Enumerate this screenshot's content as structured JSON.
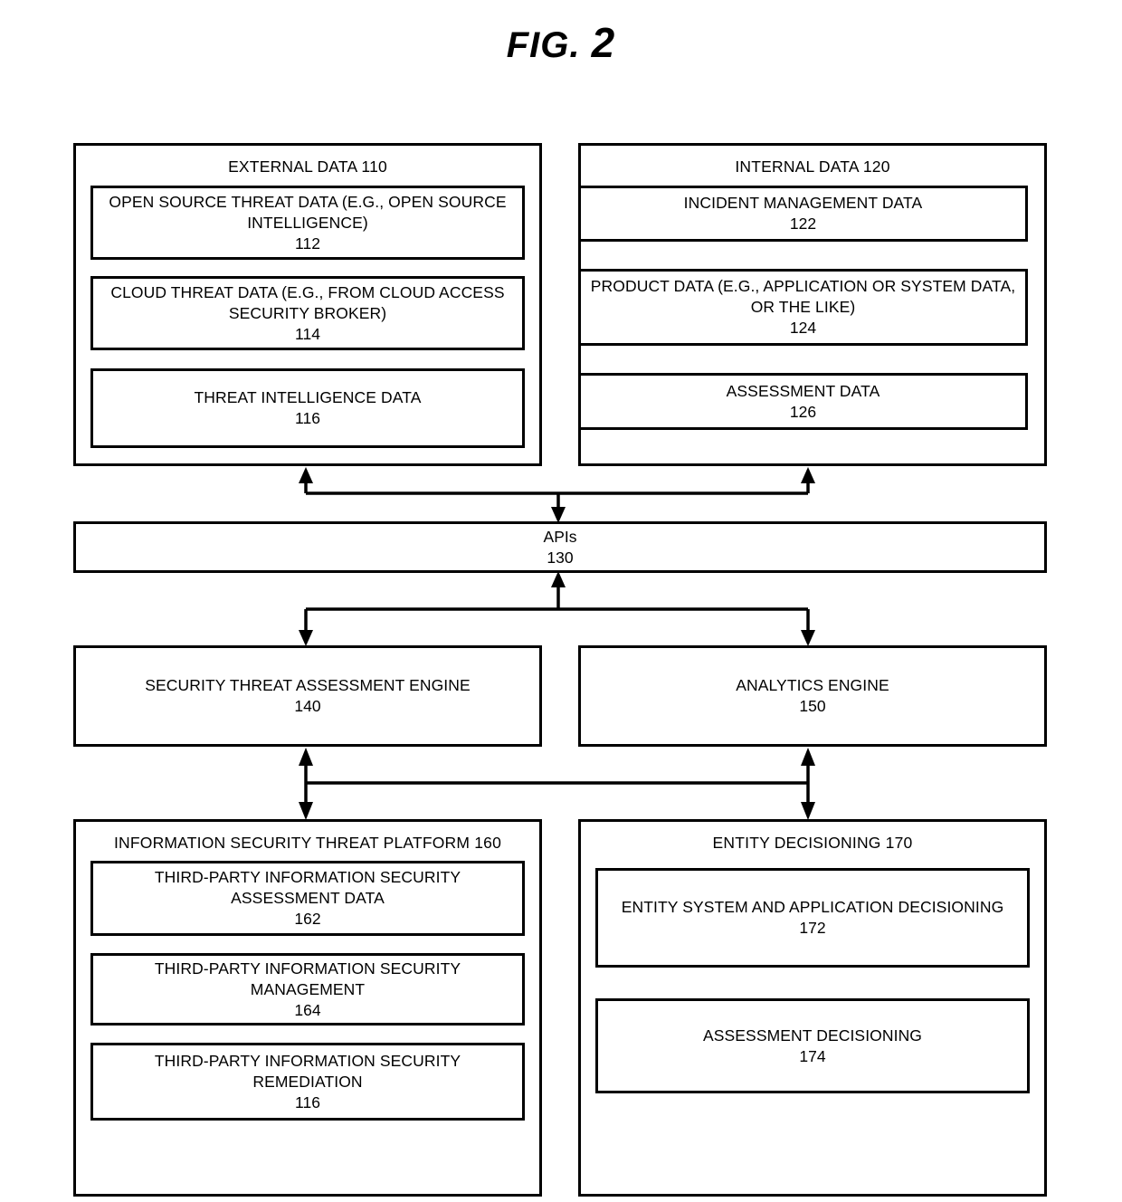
{
  "figure": {
    "label": "FIG.",
    "number": "2"
  },
  "groups": {
    "external_data": {
      "title": "EXTERNAL DATA 110",
      "items": [
        {
          "text": "OPEN SOURCE THREAT DATA (E.G., OPEN SOURCE INTELLIGENCE)",
          "num": "112"
        },
        {
          "text": "CLOUD THREAT DATA (E.G., FROM CLOUD ACCESS SECURITY BROKER)",
          "num": "114"
        },
        {
          "text": "THREAT INTELLIGENCE DATA",
          "num": "116"
        }
      ]
    },
    "internal_data": {
      "title": "INTERNAL DATA 120",
      "items": [
        {
          "text": "INCIDENT MANAGEMENT DATA",
          "num": "122"
        },
        {
          "text": "PRODUCT DATA (E.G., APPLICATION OR SYSTEM DATA, OR THE LIKE)",
          "num": "124"
        },
        {
          "text": "ASSESSMENT DATA",
          "num": "126"
        }
      ]
    },
    "apis": {
      "text": "APIs",
      "num": "130"
    },
    "security_threat_assessment_engine": {
      "text": "SECURITY THREAT ASSESSMENT ENGINE",
      "num": "140"
    },
    "analytics_engine": {
      "text": "ANALYTICS ENGINE",
      "num": "150"
    },
    "information_security_threat_platform": {
      "title": "INFORMATION SECURITY THREAT PLATFORM 160",
      "items": [
        {
          "text": "THIRD-PARTY INFORMATION SECURITY ASSESSMENT DATA",
          "num": "162"
        },
        {
          "text": "THIRD-PARTY INFORMATION SECURITY MANAGEMENT",
          "num": "164"
        },
        {
          "text": "THIRD-PARTY INFORMATION SECURITY REMEDIATION",
          "num": "116"
        }
      ]
    },
    "entity_decisioning": {
      "title": "ENTITY DECISIONING 170",
      "items": [
        {
          "text": "ENTITY SYSTEM AND APPLICATION DECISIONING",
          "num": "172"
        },
        {
          "text": "ASSESSMENT DECISIONING",
          "num": "174"
        }
      ]
    }
  },
  "colors": {
    "stroke": "#000000",
    "background": "#ffffff"
  }
}
